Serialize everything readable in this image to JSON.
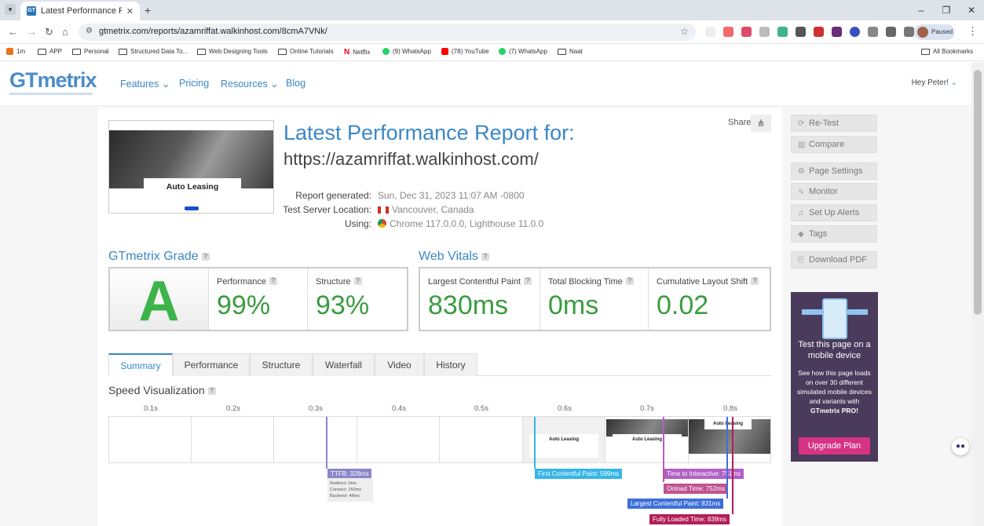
{
  "browser": {
    "tab_title": "Latest Performance Report for:",
    "tab_favicon": "GT",
    "url": "gtmetrix.com/reports/azamriffat.walkinhost.com/8cmA7VNk/",
    "profile_label": "Paused",
    "bookmarks": [
      "1m",
      "APP",
      "Personal",
      "Structured Data To...",
      "Web Designing Tools",
      "Online Tutorials",
      "Netflix",
      "(9) WhatsApp",
      "(78) YouTube",
      "(7) WhatsApp",
      "Naat"
    ],
    "all_bookmarks": "All Bookmarks"
  },
  "site": {
    "logo": "GTmetrix",
    "nav": [
      "Features",
      "Pricing",
      "Resources",
      "Blog"
    ],
    "greeting": "Hey Peter!"
  },
  "report": {
    "title": "Latest Performance Report for:",
    "url": "https://azamriffat.walkinhost.com/",
    "share_label": "Share",
    "thumbnail_banner": "Auto Leasing",
    "meta": [
      {
        "label": "Report generated:",
        "value": "Sun, Dec 31, 2023 11:07 AM -0800"
      },
      {
        "label": "Test Server Location:",
        "value": "Vancouver, Canada"
      },
      {
        "label": "Using:",
        "value": "Chrome 117.0.0.0, Lighthouse 11.0.0"
      }
    ]
  },
  "grade": {
    "heading": "GTmetrix Grade",
    "letter": "A",
    "performance_label": "Performance",
    "performance_value": "99%",
    "structure_label": "Structure",
    "structure_value": "93%"
  },
  "vitals": {
    "heading": "Web Vitals",
    "lcp_label": "Largest Contentful Paint",
    "lcp_value": "830ms",
    "tbt_label": "Total Blocking Time",
    "tbt_value": "0ms",
    "cls_label": "Cumulative Layout Shift",
    "cls_value": "0.02"
  },
  "tabs": [
    "Summary",
    "Performance",
    "Structure",
    "Waterfall",
    "Video",
    "History"
  ],
  "speed": {
    "heading": "Speed Visualization",
    "ticks": [
      "0.1s",
      "0.2s",
      "0.3s",
      "0.4s",
      "0.5s",
      "0.6s",
      "0.7s",
      "0.8s"
    ],
    "frame_text": "Auto Leasing",
    "ttfb_label": "TTFB: 328ms",
    "ttfb_detail": [
      "Redirect: 0ms",
      "Connect: 250ms",
      "Backend: 48ms"
    ],
    "markers": [
      {
        "label": "First Contentful Paint: 589ms",
        "color": "#35b6e8"
      },
      {
        "label": "Time to Interactive: 751ms",
        "color": "#b25fc7"
      },
      {
        "label": "Onload Time: 752ms",
        "color": "#c0528f"
      },
      {
        "label": "Largest Contentful Paint: 831ms",
        "color": "#3d6fd9"
      },
      {
        "label": "Fully Loaded Time: 839ms",
        "color": "#b21f5a"
      }
    ],
    "ttfb_color": "#8b86c9"
  },
  "sidebar": {
    "buttons": [
      "Re-Test",
      "Compare",
      "Page Settings",
      "Monitor",
      "Set Up Alerts",
      "Tags",
      "Download PDF"
    ],
    "promo_title": "Test this page on a mobile device",
    "promo_text": "See how this page loads on over 30 different simulated mobile devices and variants with",
    "promo_brand": "GTmetrix PRO!",
    "upgrade_label": "Upgrade Plan"
  }
}
